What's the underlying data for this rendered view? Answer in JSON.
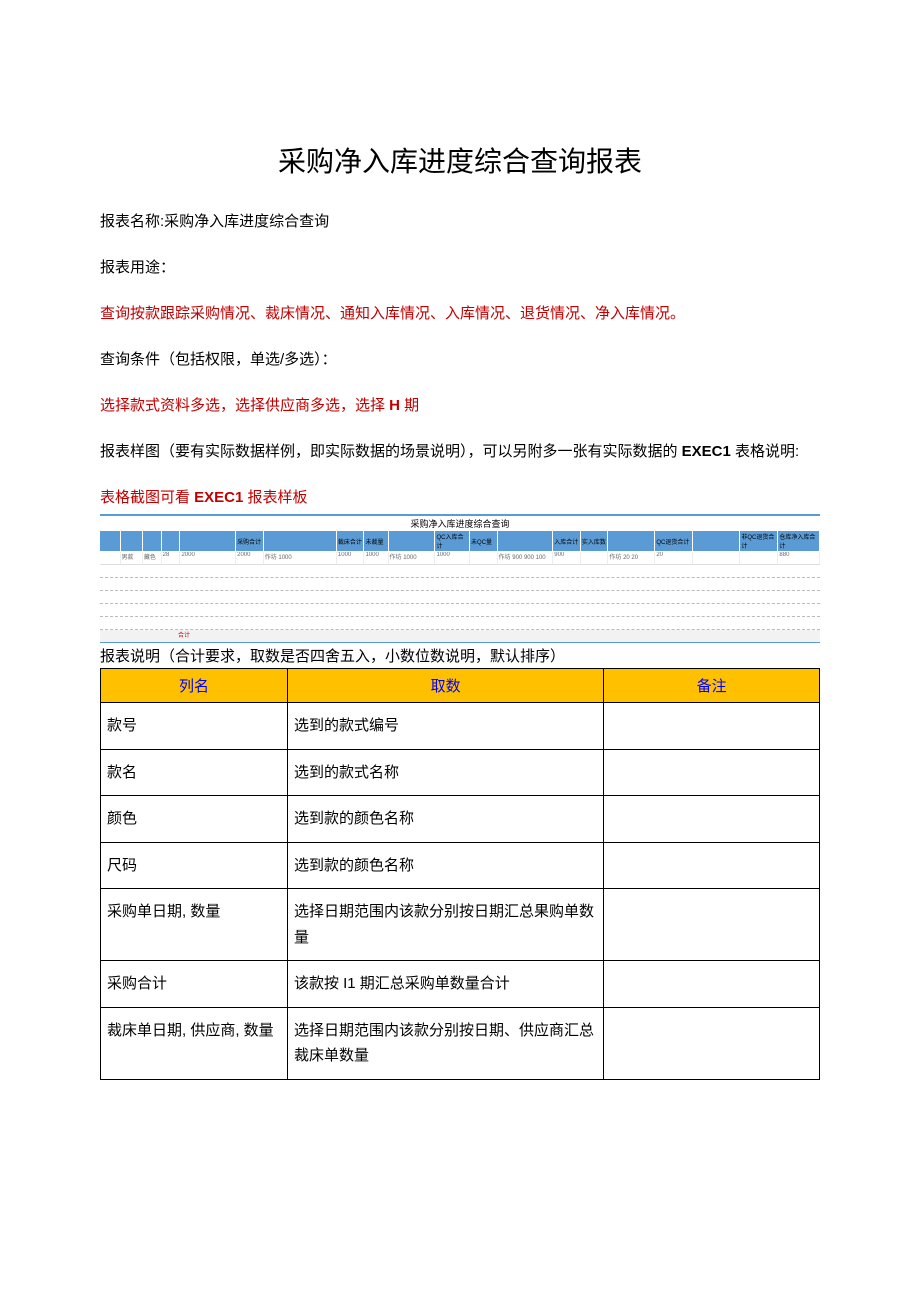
{
  "title": "采购净入库进度综合查询报表",
  "report_name_label": "报表名称:采购净入库进度综合查询",
  "report_use_label": "报表用途：",
  "use_desc": "查询按款跟踪采购情况、裁床情况、通知入库情况、入库情况、退货情况、净入库情况。",
  "query_cond_label": "查询条件（包括权限，单选/多选）：",
  "query_cond_desc_a": "选择款式资料多选，选择供应商多选，选择 ",
  "query_cond_desc_b": "H",
  "query_cond_desc_c": " 期",
  "sample_label_a": "报表样图（要有实际数据样例，即实际数据的场景说明），可以另附多一张有实际数据的 ",
  "sample_label_b": "EXEC1",
  "sample_label_c": " 表格说明:",
  "sample_link_a": "表格截图可看 ",
  "sample_link_b": "EXEC1",
  "sample_link_c": " 报表样板",
  "sample_table_title": "采购净入库进度综合查询",
  "desc_intro": "报表说明（合计要求，取数是否四舍五入，小数位数说明，默认排序）",
  "desc_table": {
    "headers": [
      "列名",
      "取数",
      "备注"
    ],
    "rows": [
      {
        "c1": "款号",
        "c2": "选到的款式编号",
        "c3": ""
      },
      {
        "c1": "款名",
        "c2": "选到的款式名称",
        "c3": ""
      },
      {
        "c1": "颜色",
        "c2": "选到款的颜色名称",
        "c3": ""
      },
      {
        "c1": "尺码",
        "c2": "选到款的颜色名称",
        "c3": ""
      },
      {
        "c1": "采购单日期, 数量",
        "c2": "选择日期范围内该款分别按日期汇总果购单数量",
        "c3": ""
      },
      {
        "c1": "采购合计",
        "c2": "该款按 I1 期汇总采购单数量合计",
        "c3": ""
      },
      {
        "c1": "裁床单日期, 供应商, 数量",
        "c2": "选择日期范围内该款分别按日期、供应商汇总裁床单数量",
        "c3": ""
      }
    ]
  },
  "sample_footer_label": "合计"
}
